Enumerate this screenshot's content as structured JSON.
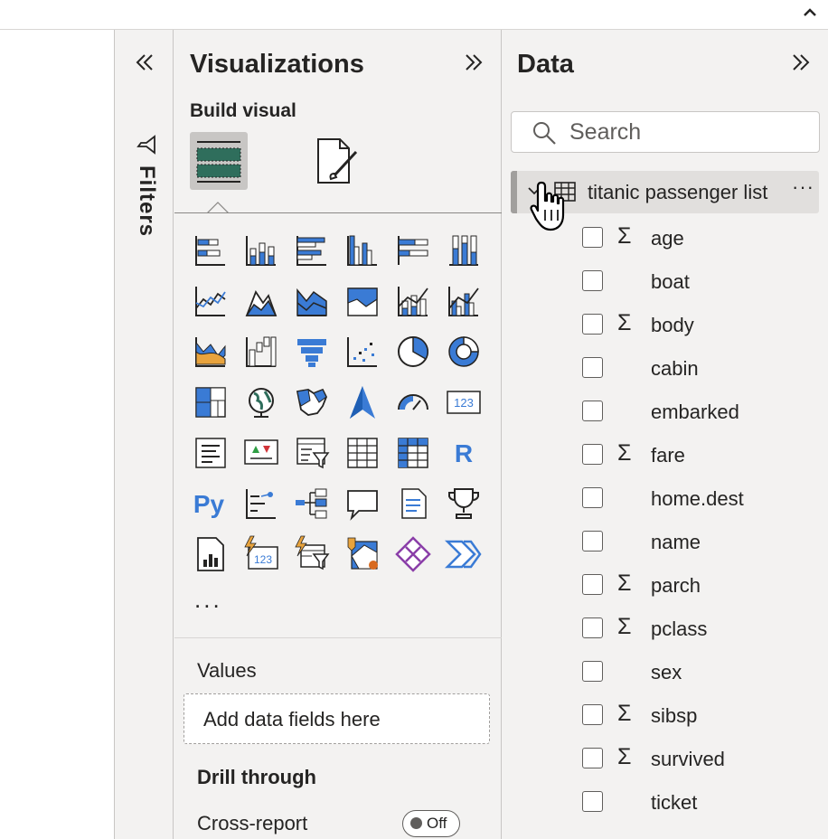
{
  "filters": {
    "label": "Filters"
  },
  "visualizations": {
    "title": "Visualizations",
    "build_label": "Build visual",
    "more": "...",
    "values_label": "Values",
    "drop_placeholder": "Add data fields here",
    "drill_label": "Drill through",
    "cross_report_label": "Cross-report",
    "toggle_state": "Off",
    "icons": [
      "stacked-bar-chart-icon",
      "stacked-column-chart-icon",
      "clustered-bar-chart-icon",
      "clustered-column-chart-icon",
      "100-stacked-bar-chart-icon",
      "100-stacked-column-chart-icon",
      "line-chart-icon",
      "area-chart-icon",
      "stacked-area-chart-icon",
      "100-stacked-area-chart-icon",
      "line-stacked-column-chart-icon",
      "line-clustered-column-chart-icon",
      "ribbon-chart-icon",
      "waterfall-chart-icon",
      "funnel-chart-icon",
      "scatter-chart-icon",
      "pie-chart-icon",
      "donut-chart-icon",
      "treemap-icon",
      "map-icon",
      "filled-map-icon",
      "azure-map-icon",
      "gauge-icon",
      "card-icon",
      "multi-row-card-icon",
      "kpi-icon",
      "slicer-icon",
      "table-icon",
      "matrix-icon",
      "r-script-visual-icon",
      "python-visual-icon",
      "key-influencers-icon",
      "decomposition-tree-icon",
      "qa-icon",
      "smart-narrative-icon",
      "metrics-icon",
      "paginated-report-icon",
      "power-apps-card-icon",
      "power-apps-slicer-icon",
      "arcgis-map-icon",
      "power-apps-icon",
      "power-automate-icon"
    ]
  },
  "data_pane": {
    "title": "Data",
    "search_placeholder": "Search",
    "table_name": "titanic passenger list",
    "table_more": "···",
    "fields": [
      {
        "name": "age",
        "sigma": "Σ"
      },
      {
        "name": "boat",
        "sigma": ""
      },
      {
        "name": "body",
        "sigma": "Σ"
      },
      {
        "name": "cabin",
        "sigma": ""
      },
      {
        "name": "embarked",
        "sigma": ""
      },
      {
        "name": "fare",
        "sigma": "Σ"
      },
      {
        "name": "home.dest",
        "sigma": ""
      },
      {
        "name": "name",
        "sigma": ""
      },
      {
        "name": "parch",
        "sigma": "Σ"
      },
      {
        "name": "pclass",
        "sigma": "Σ"
      },
      {
        "name": "sex",
        "sigma": ""
      },
      {
        "name": "sibsp",
        "sigma": "Σ"
      },
      {
        "name": "survived",
        "sigma": "Σ"
      },
      {
        "name": "ticket",
        "sigma": ""
      }
    ]
  },
  "colors": {
    "accent_blue": "#3a7bd5",
    "accent_green": "#2f6e5c",
    "text": "#252423"
  }
}
